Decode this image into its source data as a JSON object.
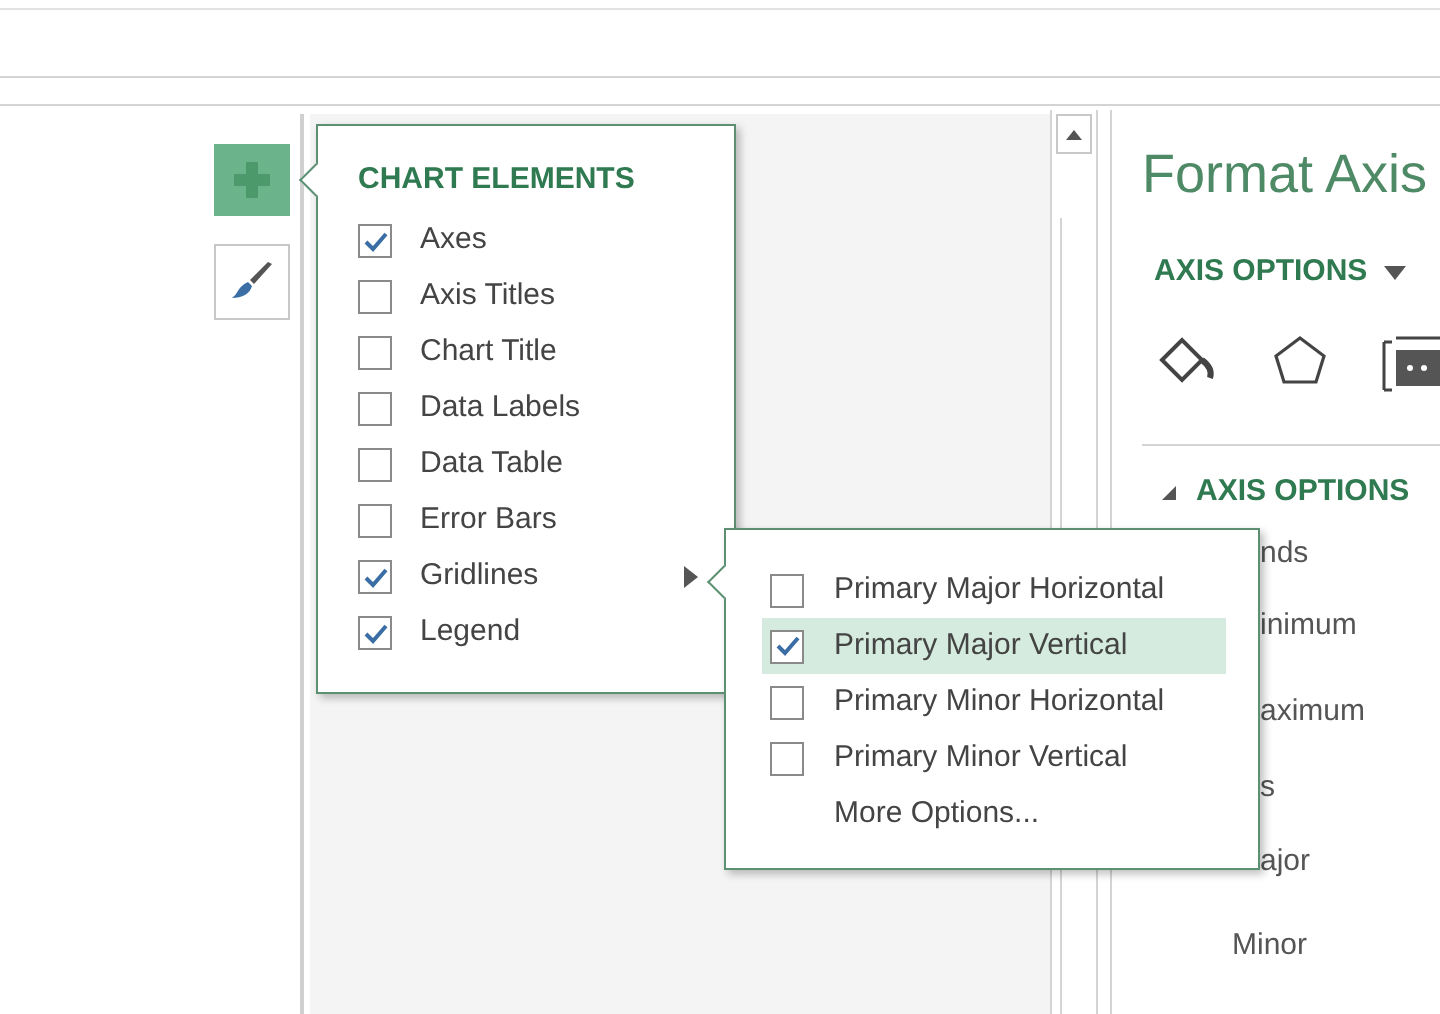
{
  "chart_elements": {
    "title": "CHART ELEMENTS",
    "items": [
      {
        "label": "Axes",
        "checked": true,
        "has_submenu": false
      },
      {
        "label": "Axis Titles",
        "checked": false,
        "has_submenu": false
      },
      {
        "label": "Chart Title",
        "checked": false,
        "has_submenu": false
      },
      {
        "label": "Data Labels",
        "checked": false,
        "has_submenu": false
      },
      {
        "label": "Data Table",
        "checked": false,
        "has_submenu": false
      },
      {
        "label": "Error Bars",
        "checked": false,
        "has_submenu": false
      },
      {
        "label": "Gridlines",
        "checked": true,
        "has_submenu": true
      },
      {
        "label": "Legend",
        "checked": true,
        "has_submenu": false
      }
    ]
  },
  "gridlines_submenu": {
    "items": [
      {
        "label": "Primary Major Horizontal",
        "checked": false,
        "selected": false
      },
      {
        "label": "Primary Major Vertical",
        "checked": true,
        "selected": true
      },
      {
        "label": "Primary Minor Horizontal",
        "checked": false,
        "selected": false
      },
      {
        "label": "Primary Minor Vertical",
        "checked": false,
        "selected": false
      }
    ],
    "more_options": "More Options..."
  },
  "format_pane": {
    "title": "Format Axis",
    "options_menu": "AXIS OPTIONS",
    "section": "AXIS OPTIONS",
    "labels": [
      {
        "text": "nds",
        "kind": "partial"
      },
      {
        "text": "inimum",
        "kind": "partial"
      },
      {
        "text": "aximum",
        "kind": "partial"
      },
      {
        "text": "s",
        "kind": "partial"
      },
      {
        "text": "ajor",
        "kind": "partial"
      },
      {
        "text": "Minor",
        "kind": "sub"
      }
    ]
  }
}
